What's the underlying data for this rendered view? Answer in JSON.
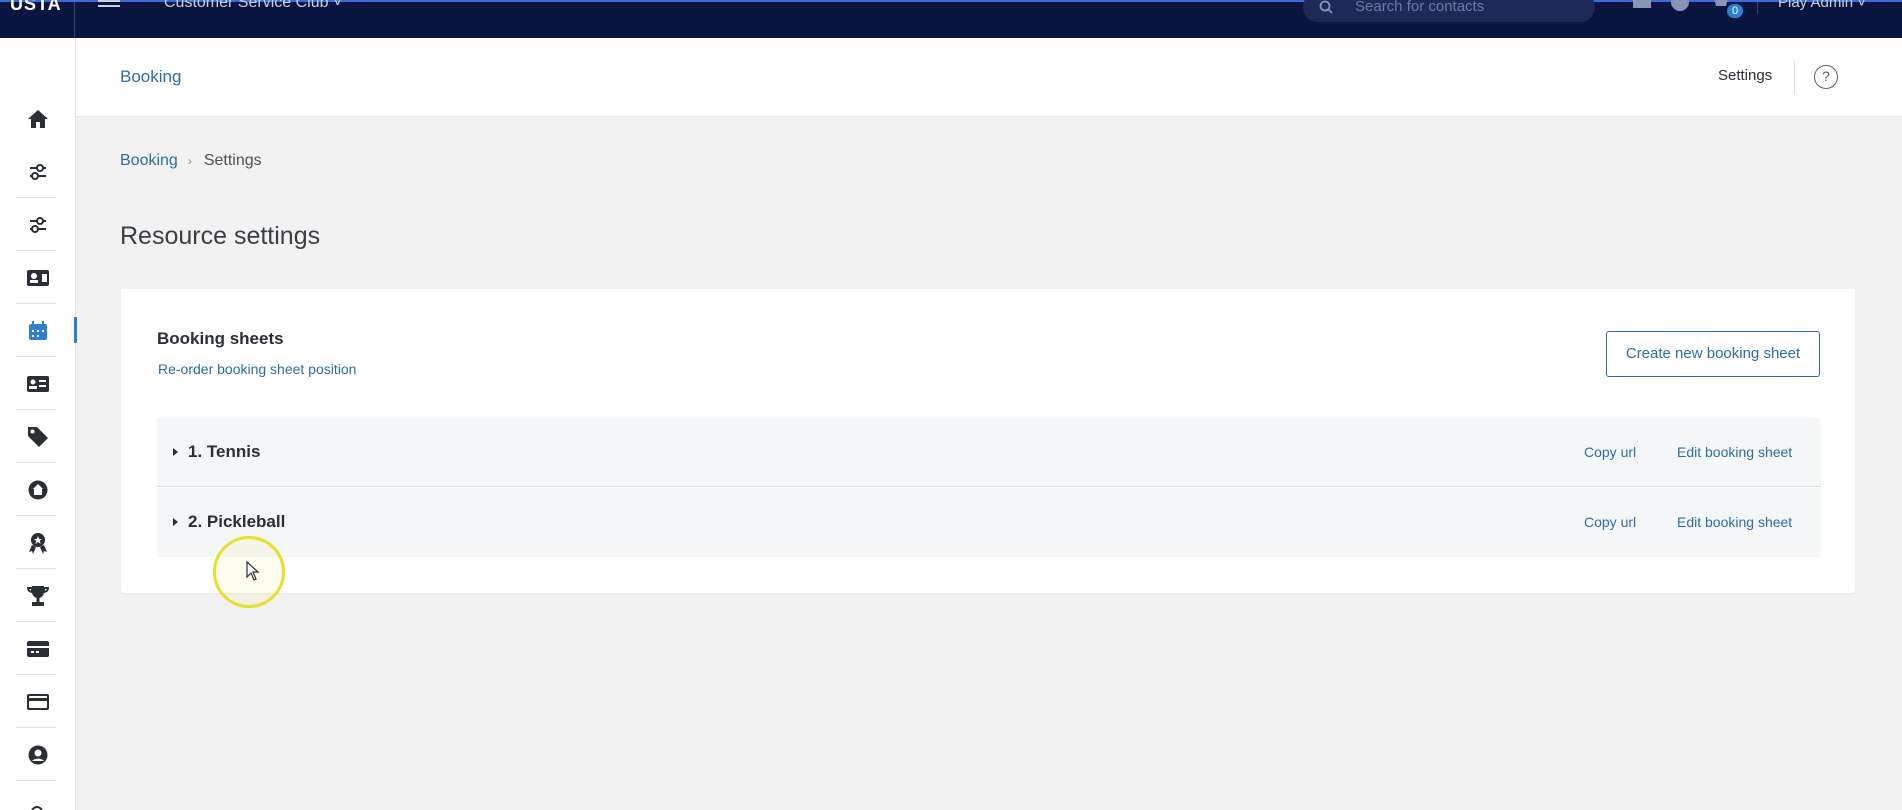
{
  "topbar": {
    "logo": "USTA",
    "club": "Customer Service Club ˅",
    "search_placeholder": "Search for contacts",
    "badge_count": "0",
    "user": "Play Admin ˅"
  },
  "sidebar": {
    "items": [
      {
        "icon": "home-icon"
      },
      {
        "icon": "sliders-icon"
      },
      {
        "icon": "sliders-icon-2"
      },
      {
        "icon": "contact-card-icon"
      },
      {
        "icon": "calendar-icon",
        "active": true
      },
      {
        "icon": "id-card-icon"
      },
      {
        "icon": "tags-icon"
      },
      {
        "icon": "facility-icon"
      },
      {
        "icon": "award-icon"
      },
      {
        "icon": "trophy-icon"
      },
      {
        "icon": "ticket-icon"
      },
      {
        "icon": "credit-card-icon"
      },
      {
        "icon": "user-circle-icon"
      }
    ],
    "accent_color": "#2f7fd0"
  },
  "header": {
    "title": "Booking",
    "settings_label": "Settings",
    "help_label": "?"
  },
  "breadcrumb": {
    "items": [
      "Booking",
      "Settings"
    ]
  },
  "page_title": "Resource settings",
  "card": {
    "title": "Booking sheets",
    "reorder_label": "Re-order booking sheet position",
    "create_button": "Create new booking sheet",
    "sheets": [
      {
        "name": "1. Tennis",
        "copy_label": "Copy url",
        "edit_label": "Edit booking sheet"
      },
      {
        "name": "2. Pickleball",
        "copy_label": "Copy url",
        "edit_label": "Edit booking sheet"
      }
    ]
  }
}
